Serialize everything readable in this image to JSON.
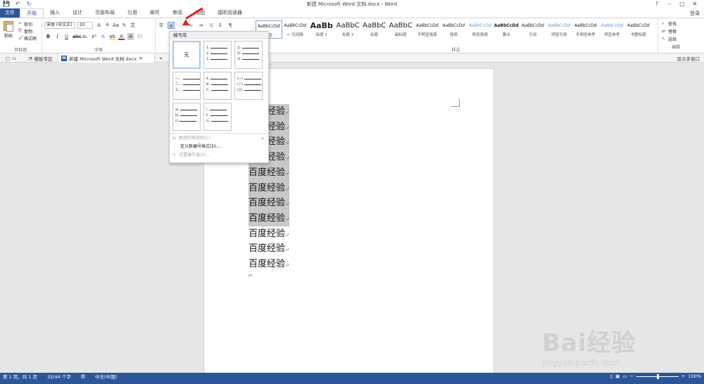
{
  "window": {
    "title": "新建 Microsoft Word 文档.docx - Word"
  },
  "qat": {
    "save": "💾",
    "undo": "↶",
    "redo": "↻"
  },
  "tabs": {
    "file": "文件",
    "items": [
      "开始",
      "插入",
      "设计",
      "页面布局",
      "引用",
      "邮件",
      "审阅",
      "视图",
      "福昕阅读器"
    ],
    "login": "登录"
  },
  "clipboard": {
    "paste": "粘贴",
    "cut": "剪切",
    "copy": "复制",
    "format_painter": "格式刷",
    "label": "剪贴板"
  },
  "font": {
    "name": "宋体 (中文正)",
    "size": "20",
    "label": "字体"
  },
  "paragraph": {
    "label": "段落"
  },
  "styles": {
    "label": "样式",
    "items": [
      {
        "sample": "AaBbCcDd",
        "name": "正文"
      },
      {
        "sample": "AaBbCcDd",
        "name": "↵ 无间隔"
      },
      {
        "sample": "AaBb",
        "name": "标题 1"
      },
      {
        "sample": "AaBbC",
        "name": "标题 2"
      },
      {
        "sample": "AaBbC",
        "name": "标题"
      },
      {
        "sample": "AaBbC",
        "name": "副标题"
      },
      {
        "sample": "AaBbCcDd",
        "name": "不明显强调"
      },
      {
        "sample": "AaBbCcDd",
        "name": "强调"
      },
      {
        "sample": "AaBbCcDd",
        "name": "明显强调"
      },
      {
        "sample": "AaBbCcDd",
        "name": "要点"
      },
      {
        "sample": "AaBbCcDd",
        "name": "引用"
      },
      {
        "sample": "AaBbCcDd",
        "name": "明显引用"
      },
      {
        "sample": "AaBbCcDd",
        "name": "不明显参考"
      },
      {
        "sample": "AaBbCcDd",
        "name": "明显参考"
      },
      {
        "sample": "AaBbCcDd",
        "name": "书籍标题"
      }
    ]
  },
  "editing": {
    "find": "查找",
    "replace": "替换",
    "select": "选择",
    "label": "编辑"
  },
  "docbar": {
    "home_tab": "模板专区",
    "doc_tab": "新建 Microsoft Word 文档.docx",
    "multi_view": "显示多窗口"
  },
  "document": {
    "lines": [
      "百度经验",
      "百度经验",
      "百度经验",
      "百度经验",
      "百度经验",
      "百度经验",
      "百度经验",
      "百度经验",
      "百度经验",
      "百度经验",
      "百度经验"
    ],
    "selected_count": 8,
    "para_mark": "↵"
  },
  "numbering": {
    "header": "编号库",
    "none_label": "无",
    "cells": [
      [
        "1.",
        "2.",
        "3."
      ],
      [
        "1)",
        "2)",
        "3)"
      ],
      [
        "一、",
        "二、",
        "三、"
      ],
      [
        "A.",
        "B.",
        "C."
      ],
      [
        "(一)",
        "(二)",
        "(三)"
      ],
      [
        "a)",
        "b)",
        "c)"
      ],
      [
        "i.",
        "ii.",
        "iii."
      ]
    ],
    "menu": {
      "change_level": "更改列表级别(C)",
      "define_new": "定义新编号格式(D)...",
      "set_value": "设置编号值(V)..."
    }
  },
  "status": {
    "page": "第 1 页，共 1 页",
    "words": "32/44 个字",
    "lang": "中文(中国)",
    "zoom": "100%"
  },
  "watermark": {
    "main": "Bai经验",
    "sub": "jingyan.baidu.com"
  },
  "colors": {
    "accent": "#2b579a",
    "selection": "#c8c8c8",
    "arrow": "#e02020"
  }
}
